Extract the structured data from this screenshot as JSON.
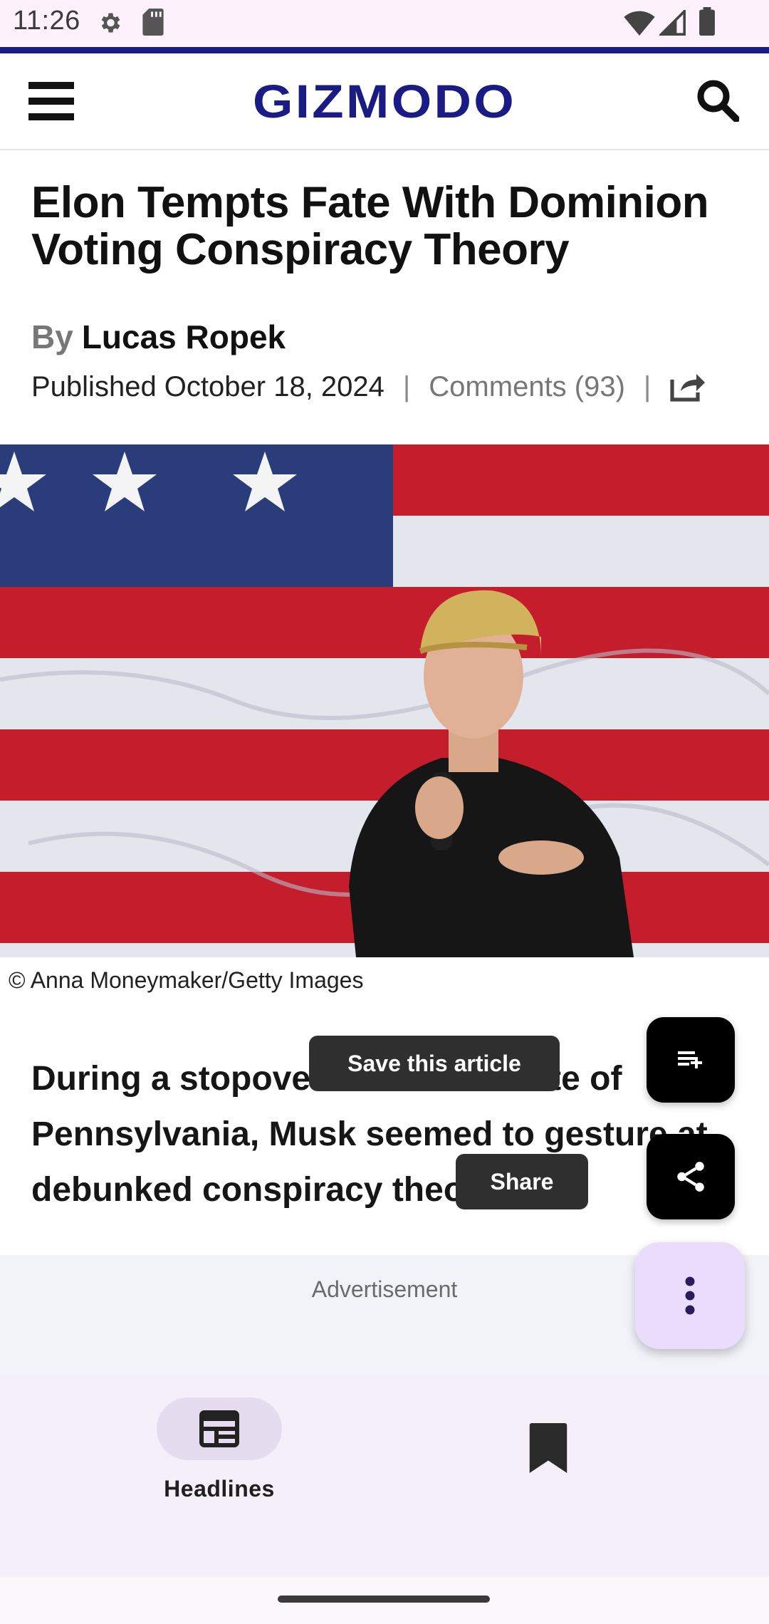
{
  "status_bar": {
    "time": "11:26"
  },
  "header": {
    "logo_text": "GIZMODO",
    "brand_color": "#1b1b86"
  },
  "article": {
    "title": "Elon Tempts Fate With Dominion Voting Conspiracy Theory",
    "byline_prefix": "By",
    "author": "Lucas Ropek",
    "published": "Published October 18, 2024",
    "separator": "|",
    "comments": "Comments (93)",
    "photo_credit": "© Anna Moneymaker/Getty Images",
    "body_visible": "During a stopover fo                                    otal sw state of Pennsylvania, Musk seemed to gesture at debunked conspiracy theories."
  },
  "tooltips": {
    "save": "Save this article",
    "share": "Share"
  },
  "advertisement": {
    "label": "Advertisement"
  },
  "bottom_nav": {
    "headlines_label": "Headlines"
  },
  "icons": {
    "status": [
      "gear-icon",
      "sd-card-icon",
      "wifi-icon",
      "signal-icon",
      "battery-icon"
    ],
    "header": [
      "menu-icon",
      "search-icon"
    ],
    "fabs": [
      "playlist-add-icon",
      "share-icon",
      "more-vert-icon"
    ],
    "nav": [
      "newspaper-icon",
      "bookmark-icon"
    ]
  },
  "colors": {
    "fab_more_bg": "#eadcfb",
    "nav_bg": "#f4eff8",
    "status_bg": "#fdf1fb"
  }
}
